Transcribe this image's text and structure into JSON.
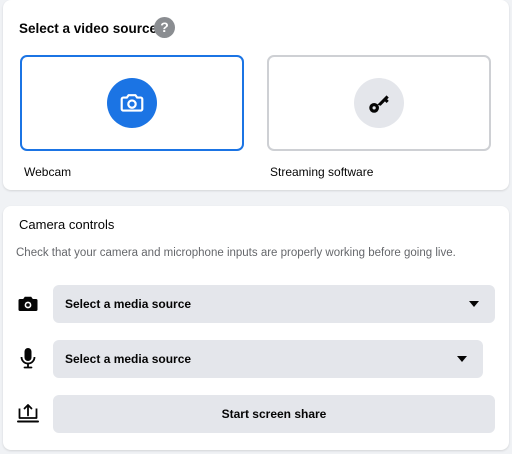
{
  "video_source": {
    "title": "Select a video source",
    "help_glyph": "?",
    "options": [
      {
        "label": "Webcam",
        "icon": "camera-icon",
        "selected": true
      },
      {
        "label": "Streaming software",
        "icon": "key-icon",
        "selected": false
      }
    ]
  },
  "camera_controls": {
    "title": "Camera controls",
    "description": "Check that your camera and microphone inputs are properly working before going live.",
    "camera_select": {
      "icon": "camera-icon",
      "value": "Select a media source"
    },
    "microphone_select": {
      "icon": "microphone-icon",
      "value": "Select a media source"
    },
    "screen_share": {
      "icon": "screen-share-icon",
      "label": "Start screen share"
    }
  },
  "colors": {
    "accent": "#1b74e4",
    "background": "#f0f2f5",
    "control_fill": "#e4e6eb",
    "secondary_text": "#65676b"
  }
}
